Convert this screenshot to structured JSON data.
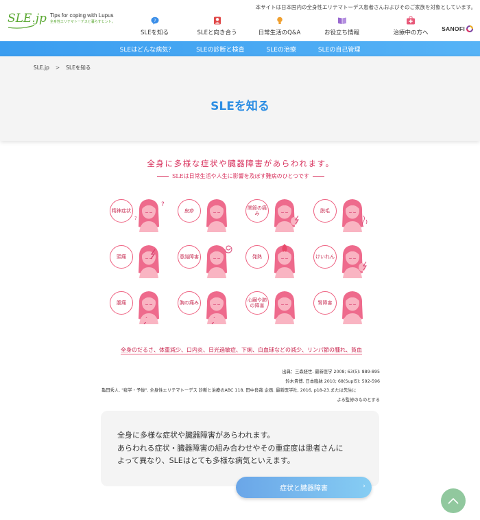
{
  "notice": "本サイトは日本国内の全身性エリテマトーデス患者さんおよびそのご家族を対象としています。",
  "logo": {
    "main": "SLE.jp",
    "tagline": "Tips for coping with Lupus",
    "tagline_jp": "全身性エリテマトーデスと暮らすヒント。"
  },
  "global_nav": [
    {
      "label": "SLEを知る",
      "icon": "question-bubble-icon",
      "color": "#3a8ee8"
    },
    {
      "label": "SLEと向き合う",
      "icon": "person-icon",
      "color": "#e04848"
    },
    {
      "label": "日常生活のQ&A",
      "icon": "lightbulb-icon",
      "color": "#f0a030"
    },
    {
      "label": "お役立ち情報",
      "icon": "book-icon",
      "color": "#9a6ad0"
    },
    {
      "label": "治療中の方へ",
      "icon": "medical-kit-icon",
      "color": "#e85a7a"
    }
  ],
  "brand": "SANOFI",
  "sub_nav": [
    "SLEはどんな病気？",
    "SLEの診断と検査",
    "SLEの治療",
    "SLEの自己管理"
  ],
  "breadcrumb": {
    "home": "SLE.jp",
    "separator": ">",
    "current": "SLEを知る"
  },
  "page_title": "SLEを知る",
  "infographic": {
    "title": "全身に多様な症状や臓器障害があらわれます。",
    "subtitle": "SLEは日常生活や人生に影響を及ぼす難病のひとつです",
    "symptoms": [
      {
        "label": "精神症状",
        "icon": "question-marks-icon"
      },
      {
        "label": "皮疹",
        "icon": "none"
      },
      {
        "label": "関節の痛み",
        "icon": "lightning-hand-icon"
      },
      {
        "label": "脱毛",
        "icon": "falling-hair-icon"
      },
      {
        "label": "頭痛",
        "icon": "lightning-head-icon"
      },
      {
        "label": "意識障害",
        "icon": "spiral-icon"
      },
      {
        "label": "発熱",
        "icon": "flame-icon"
      },
      {
        "label": "けいれん",
        "icon": "shaking-hand-icon"
      },
      {
        "label": "腹痛",
        "icon": "lightning-belly-icon"
      },
      {
        "label": "胸の痛み",
        "icon": "lightning-chest-icon"
      },
      {
        "label": "心臓や肺の障害",
        "icon": "hands-on-chest-icon"
      },
      {
        "label": "腎障害",
        "icon": "hands-on-side-icon"
      }
    ],
    "footer": "全身のだるさ、体重減少、口内炎、日光過敏症、下痢、白血球などの減少、リンパ節の腫れ、貧血"
  },
  "sources": [
    "出典：三森経世. 最新医学 2008; 63(5): 889-895",
    "鈴木貴博. 日本臨牀 2010; 68(Supl5): 592-596",
    "亀田秀人. \"疫学・予後\". 全身性エリテマトーデス 診断と治療のABC 118. 田中良哉 企画. 最新医学社, 2016, p18-23.または先生に",
    "よる監修のものとする"
  ],
  "callout": {
    "lines": [
      "全身に多様な症状や臓器障害があらわれます。",
      "あらわれる症状・臓器障害の組み合わせやその重症度は患者さんに",
      "よって異なり、SLEはとても多様な病気といえます。"
    ]
  },
  "cta": {
    "label": "症状と臓器障害",
    "icon": "chevron-right-icon"
  },
  "page_top": {
    "icon": "chevron-up-icon"
  },
  "colors": {
    "primary_blue": "#2d8ee3",
    "pink": "#e85a7a",
    "green": "#5aa832"
  }
}
